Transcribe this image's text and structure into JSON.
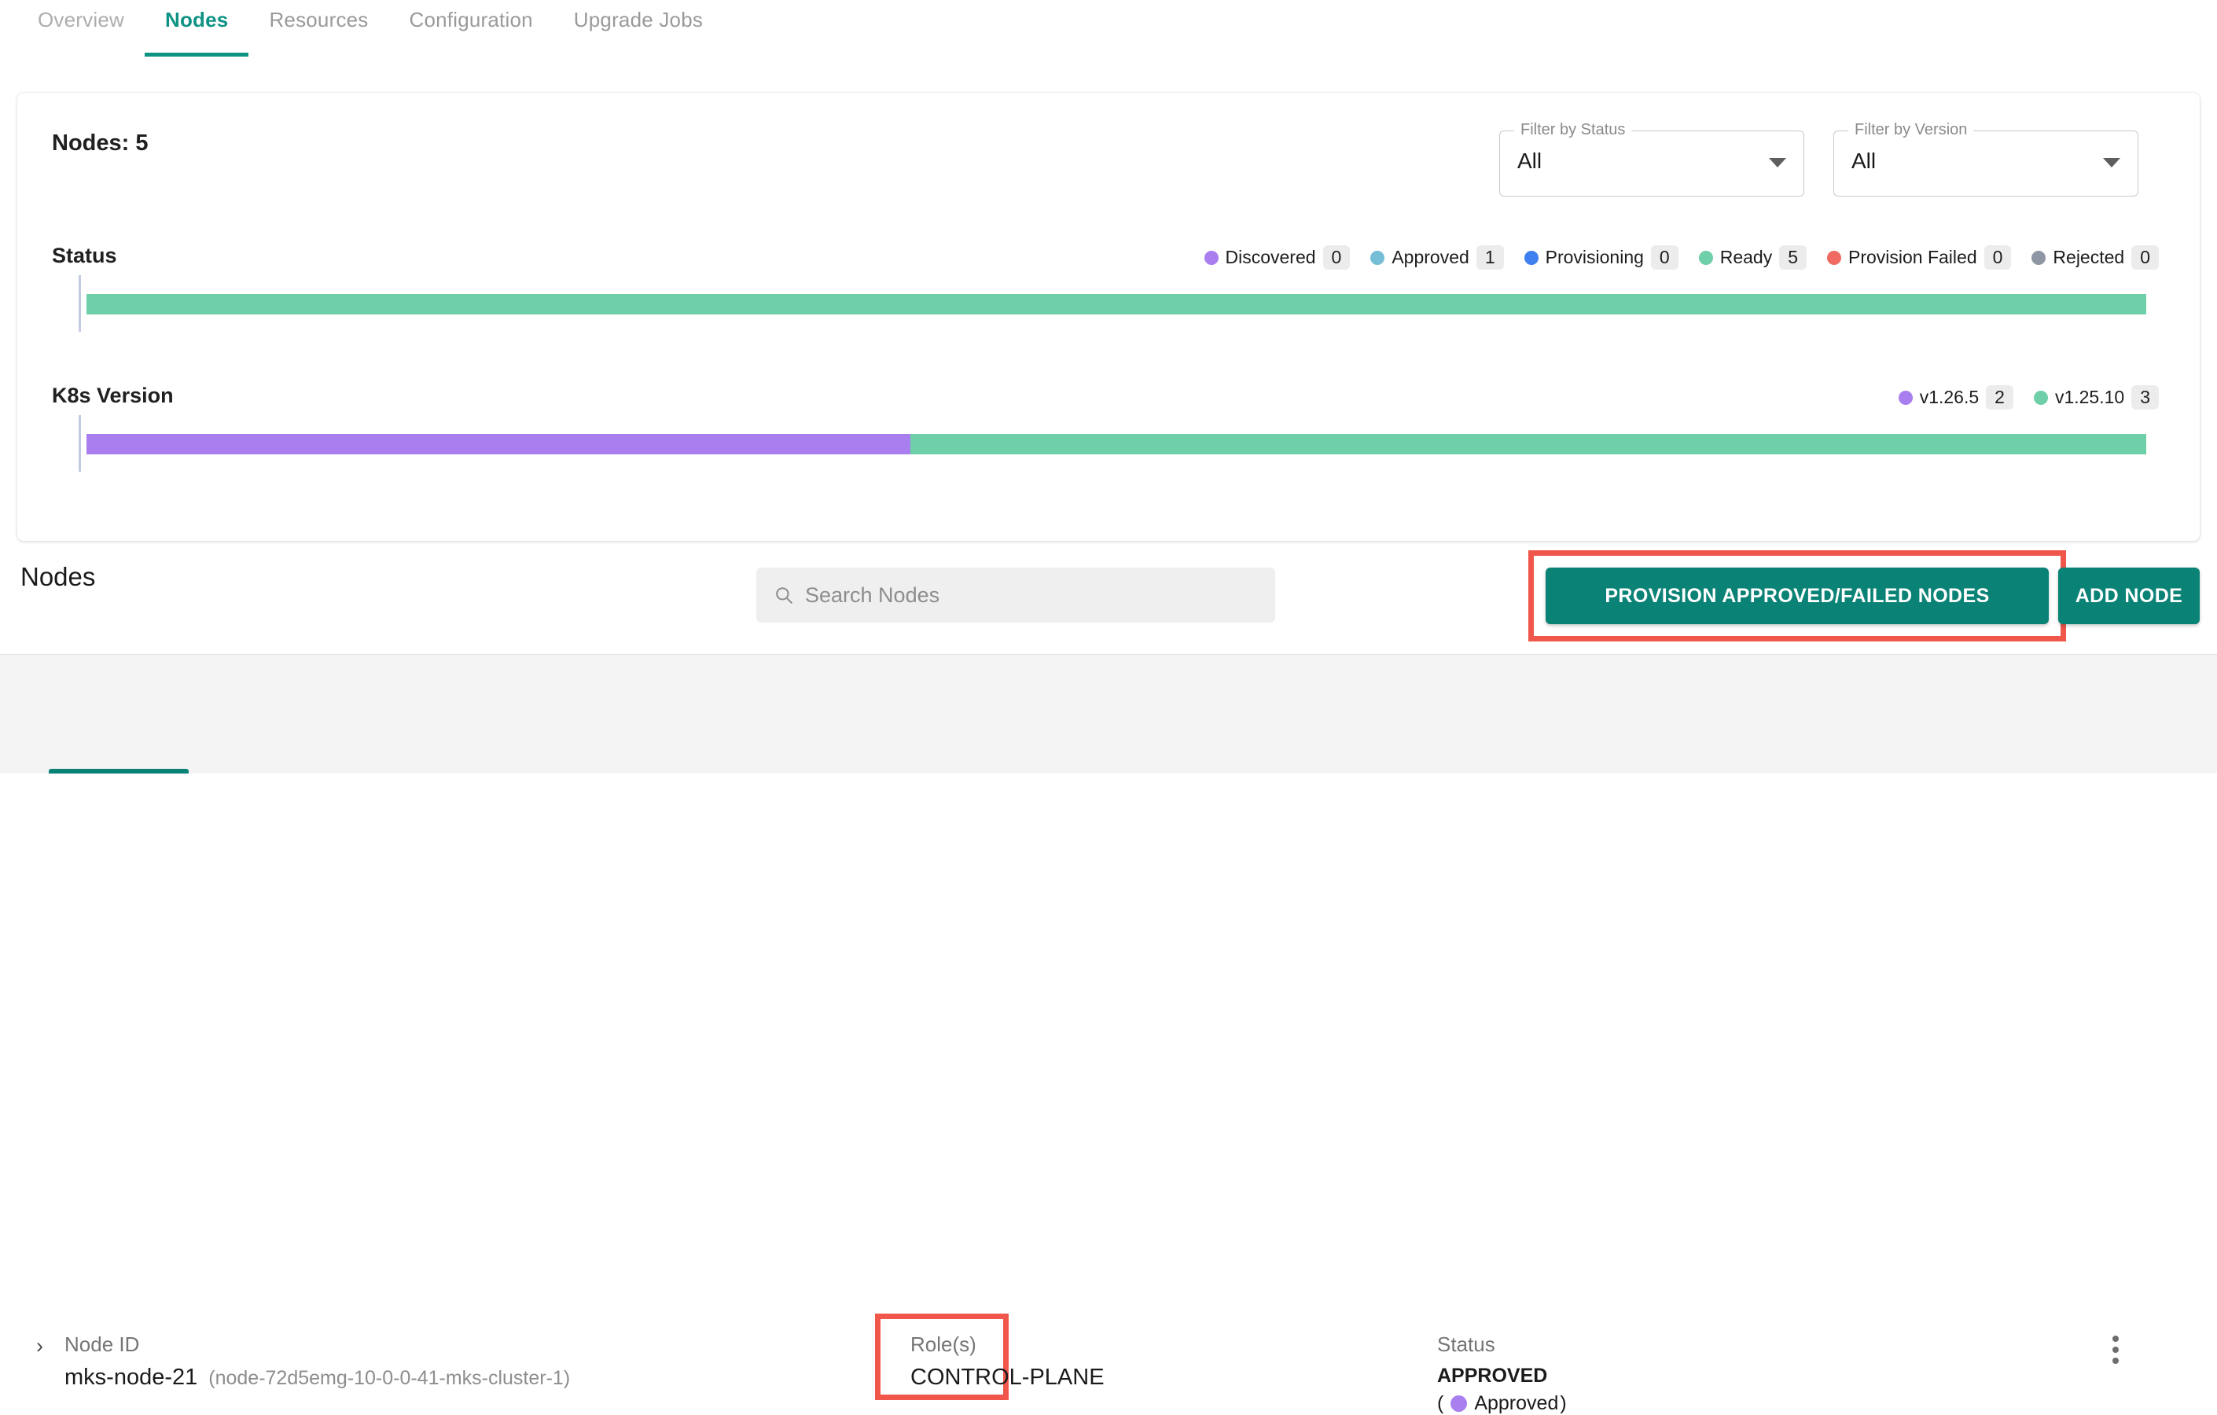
{
  "tabs": [
    {
      "label": "Overview",
      "active": false
    },
    {
      "label": "Nodes",
      "active": true
    },
    {
      "label": "Resources",
      "active": false
    },
    {
      "label": "Configuration",
      "active": false
    },
    {
      "label": "Upgrade Jobs",
      "active": false
    }
  ],
  "summary": {
    "nodes_count_label": "Nodes: 5",
    "filter_status": {
      "legend": "Filter by Status",
      "value": "All"
    },
    "filter_version": {
      "legend": "Filter by Version",
      "value": "All"
    }
  },
  "chart_data": [
    {
      "type": "bar",
      "title": "Status",
      "orientation": "horizontal-stacked",
      "total": 5,
      "categories": [
        "Discovered",
        "Approved",
        "Provisioning",
        "Ready",
        "Provision Failed",
        "Rejected"
      ],
      "values": [
        0,
        1,
        0,
        5,
        0,
        0
      ],
      "colors": [
        "#a97ff0",
        "#75bed6",
        "#3f7ff0",
        "#6fcfa8",
        "#ef6a62",
        "#8f96a3"
      ],
      "legend_position": "top-right",
      "grid": false,
      "rendered_segments": [
        {
          "name": "Ready",
          "percent": 100,
          "color": "#6fcfa8"
        }
      ]
    },
    {
      "type": "bar",
      "title": "K8s Version",
      "orientation": "horizontal-stacked",
      "total": 5,
      "categories": [
        "v1.26.5",
        "v1.25.10"
      ],
      "values": [
        2,
        3
      ],
      "colors": [
        "#a97ff0",
        "#6fcfa8"
      ],
      "legend_position": "top-right",
      "grid": false,
      "rendered_segments": [
        {
          "name": "v1.26.5",
          "percent": 40,
          "color": "#a97ff0"
        },
        {
          "name": "v1.25.10",
          "percent": 60,
          "color": "#6fcfa8"
        }
      ]
    }
  ],
  "toolbar": {
    "title": "Nodes",
    "search_placeholder": "Search Nodes",
    "search_value": "",
    "search_icon": "search-icon",
    "provision_label": "PROVISION APPROVED/FAILED NODES",
    "add_node_label": "ADD NODE"
  },
  "node_row": {
    "expand_icon": "chevron-right-icon",
    "node_id": {
      "header": "Node ID",
      "value": "mks-node-21",
      "detail": "(node-72d5emg-10-0-0-41-mks-cluster-1)"
    },
    "roles": {
      "header": "Role(s)",
      "value": "CONTROL-PLANE"
    },
    "status": {
      "header": "Status",
      "value": "APPROVED",
      "open_paren": "(",
      "sub_label": "Approved",
      "close_paren": ")",
      "dot_color": "#a97ff0"
    },
    "menu_icon": "kebab-menu-icon"
  },
  "colors": {
    "accent_teal": "#0b8276",
    "tab_active": "#0e9384",
    "annotation_red": "#f0564a",
    "purple": "#a97ff0",
    "green": "#6fcfa8"
  }
}
